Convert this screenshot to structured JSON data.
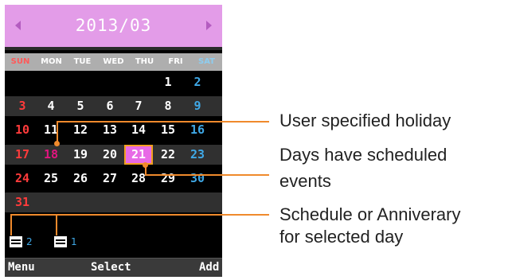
{
  "calendar": {
    "month_title": "2013/03",
    "weekdays": [
      "SUN",
      "MON",
      "TUE",
      "WED",
      "THU",
      "FRI",
      "SAT"
    ],
    "weeks": [
      [
        "",
        "",
        "",
        "",
        "",
        "1",
        "2"
      ],
      [
        "3",
        "4",
        "5",
        "6",
        "7",
        "8",
        "9"
      ],
      [
        "10",
        "11",
        "12",
        "13",
        "14",
        "15",
        "16"
      ],
      [
        "17",
        "18",
        "19",
        "20",
        "21",
        "22",
        "23"
      ],
      [
        "24",
        "25",
        "26",
        "27",
        "28",
        "29",
        "30"
      ],
      [
        "31",
        "",
        "",
        "",
        "",
        "",
        ""
      ]
    ],
    "holiday_day": "18",
    "selected_day": "21",
    "colors": {
      "header": "#e39ce8",
      "sunday": "#ff3b3b",
      "saturday": "#3fa8e6",
      "holiday": "#e2157f",
      "selected_fill": "#e86ae6",
      "selected_border": "#f2a020",
      "callout": "#f08a2c"
    }
  },
  "summary": {
    "schedule_icon": "schedule-list-icon",
    "schedule_count": "2",
    "anniversary_icon": "anniversary-calendar-icon",
    "anniversary_count": "1"
  },
  "softkeys": {
    "left": "Menu",
    "center": "Select",
    "right": "Add"
  },
  "callouts": {
    "holiday": "User specified holiday",
    "events_line1": "Days have scheduled",
    "events_line2": "events",
    "schedule_line1": "Schedule or Anniverary",
    "schedule_line2": "for selected day"
  }
}
